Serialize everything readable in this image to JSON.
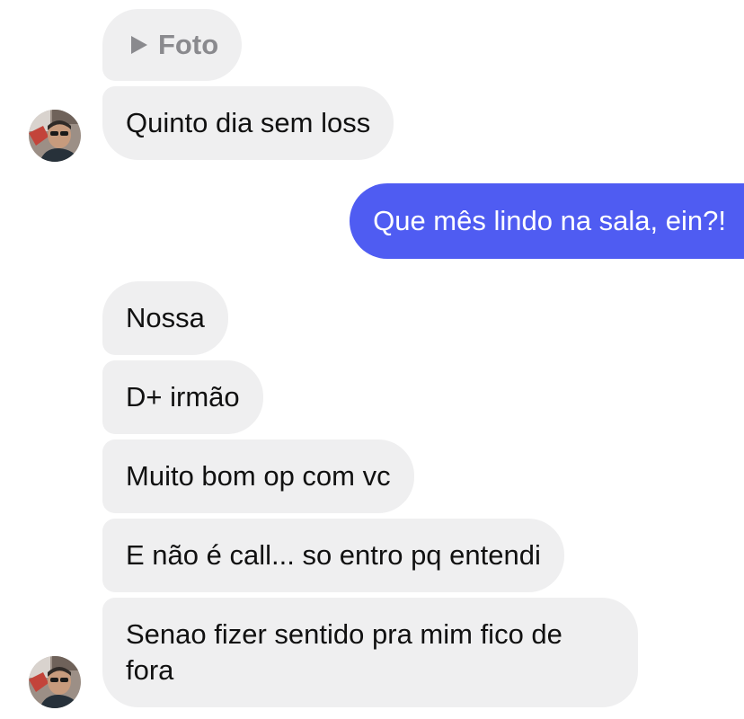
{
  "conversation": {
    "photo_label": "Foto",
    "messages": [
      {
        "text": "Quinto dia sem loss",
        "from": "contact"
      },
      {
        "text": "Que mês lindo na sala, ein?!",
        "from": "me"
      },
      {
        "text": "Nossa",
        "from": "contact"
      },
      {
        "text": "D+ irmão",
        "from": "contact"
      },
      {
        "text": "Muito bom op com vc",
        "from": "contact"
      },
      {
        "text": "E não é call... so entro pq entendi",
        "from": "contact"
      },
      {
        "text": "Senao fizer sentido pra mim fico de fora",
        "from": "contact"
      }
    ]
  },
  "icons": {
    "photo": "play-icon",
    "avatar": "contact-avatar"
  },
  "colors": {
    "incoming_bubble": "#efeff0",
    "outgoing_bubble": "#4f5cf2",
    "photo_label": "#8a8a8e"
  }
}
